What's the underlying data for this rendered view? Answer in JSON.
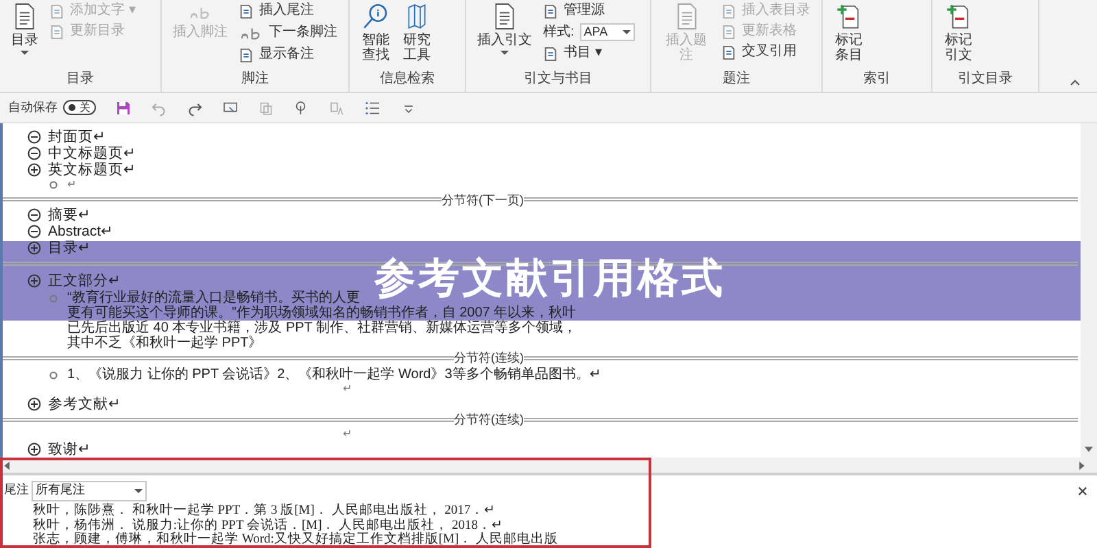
{
  "ribbon": {
    "groups": [
      {
        "label": "目录",
        "items": [
          {
            "kind": "large",
            "label": "目录",
            "disabled": false
          },
          {
            "kind": "small",
            "label": "添加文字 ▾",
            "disabled": true
          },
          {
            "kind": "small",
            "label": "更新目录",
            "disabled": true
          }
        ]
      },
      {
        "label": "脚注",
        "items": [
          {
            "kind": "large",
            "label": "插入脚注",
            "disabled": true
          },
          {
            "kind": "small",
            "label": "插入尾注",
            "disabled": false
          },
          {
            "kind": "small",
            "label": "下一条脚注",
            "disabled": false
          },
          {
            "kind": "small",
            "label": "显示备注",
            "disabled": false
          }
        ]
      },
      {
        "label": "信息检索",
        "items": [
          {
            "kind": "large",
            "label": "智能查找",
            "disabled": false
          },
          {
            "kind": "large",
            "label": "研究工具",
            "disabled": false
          }
        ]
      },
      {
        "label": "引文与书目",
        "items": [
          {
            "kind": "large",
            "label": "插入引文",
            "disabled": false
          },
          {
            "kind": "small",
            "label": "管理源",
            "disabled": false
          },
          {
            "kind": "style",
            "label": "样式:",
            "value": "APA"
          },
          {
            "kind": "small",
            "label": "书目 ▾",
            "disabled": false
          }
        ]
      },
      {
        "label": "题注",
        "items": [
          {
            "kind": "large",
            "label": "插入题注",
            "disabled": true
          },
          {
            "kind": "small",
            "label": "插入表目录",
            "disabled": true
          },
          {
            "kind": "small",
            "label": "更新表格",
            "disabled": true
          },
          {
            "kind": "small",
            "label": "交叉引用",
            "disabled": false
          }
        ]
      },
      {
        "label": "索引",
        "items": [
          {
            "kind": "large",
            "label": "标记条目",
            "disabled": false
          }
        ]
      },
      {
        "label": "引文目录",
        "items": [
          {
            "kind": "large",
            "label": "标记引文",
            "disabled": false
          }
        ]
      }
    ]
  },
  "quick_access": {
    "autosave_label": "自动保存",
    "autosave_state": "关",
    "autosave_on": false
  },
  "document": [
    {
      "kind": "heading",
      "text": "封面页↵",
      "expanded": true
    },
    {
      "kind": "heading",
      "text": "中文标题页↵",
      "expanded": true
    },
    {
      "kind": "heading",
      "text": "英文标题页↵",
      "expanded": false
    },
    {
      "kind": "empty",
      "text": "↵"
    },
    {
      "kind": "break",
      "text": "分节符(下一页)"
    },
    {
      "kind": "heading",
      "text": "摘要↵",
      "expanded": true
    },
    {
      "kind": "heading",
      "text": "Abstract↵",
      "expanded": true
    },
    {
      "kind": "heading",
      "text": "目录↵",
      "expanded": false
    },
    {
      "kind": "break"
    },
    {
      "kind": "heading",
      "text": "正文部分↵",
      "expanded": false
    },
    {
      "kind": "para",
      "lines": [
        "“教育行业最好的流量入口是畅销书。买书的人更",
        "更有可能买这个导师的课。”作为职场领域知名的畅销书作者，自 2007 年以来，秋叶",
        "已先后出版近 40 本专业书籍，涉及 PPT 制作、社群营销、新媒体运营等多个领域，",
        "其中不乏《和秋叶一起学 PPT》"
      ]
    },
    {
      "kind": "break",
      "text": "分节符(连续)"
    },
    {
      "kind": "para",
      "lines": [
        "1、《说服力 让你的 PPT 会说话》2、《和秋叶一起学 Word》3等多个畅销单品图书。↵"
      ]
    },
    {
      "kind": "blank",
      "text": "↵"
    },
    {
      "kind": "heading",
      "text": "参考文献↵",
      "expanded": false
    },
    {
      "kind": "break",
      "text": "分节符(连续)"
    },
    {
      "kind": "blank",
      "text": "↵"
    },
    {
      "kind": "heading",
      "text": "致谢↵",
      "expanded": false
    }
  ],
  "endnote_pane": {
    "label": "尾注",
    "filter": "所有尾注",
    "notes": [
      "秋叶，陈陟熹． 和秋叶一起学 PPT．第 3 版[M]． 人民邮电出版社， 2017．↵",
      "秋叶，杨伟洲． 说服力:让你的 PPT 会说话．[M]． 人民邮电出版社， 2018．↵",
      "张志，顾建，傅琳，和秋叶一起学 Word:又快又好搞定工作文档排版[M]． 人民邮电出版"
    ]
  },
  "banner": {
    "title": "参考文献引用格式"
  }
}
